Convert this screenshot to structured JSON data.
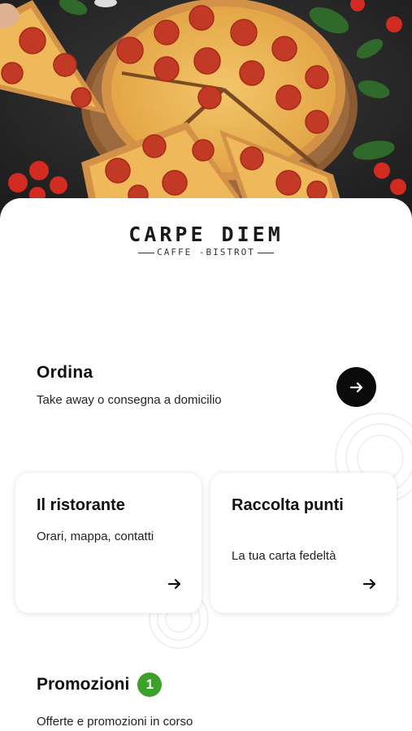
{
  "hero": {
    "image_description_icon": "pizza-photo"
  },
  "logo": {
    "main": "CARPE DIEM",
    "sub": "CAFFE -BISTROT"
  },
  "ordina": {
    "title": "Ordina",
    "subtitle": "Take away o consegna a domicilio",
    "button_icon": "arrow-right-icon"
  },
  "cards": [
    {
      "title": "Il ristorante",
      "subtitle": "Orari, mappa, contatti",
      "icon": "arrow-right-icon"
    },
    {
      "title": "Raccolta punti",
      "subtitle": "La tua carta fedeltà",
      "icon": "arrow-right-icon"
    }
  ],
  "promozioni": {
    "title": "Promozioni",
    "badge_count": "1",
    "subtitle": "Offerte e promozioni in corso"
  },
  "colors": {
    "badge_green": "#3da02b",
    "button_black": "#0b0b0b",
    "background": "#ffffff"
  }
}
